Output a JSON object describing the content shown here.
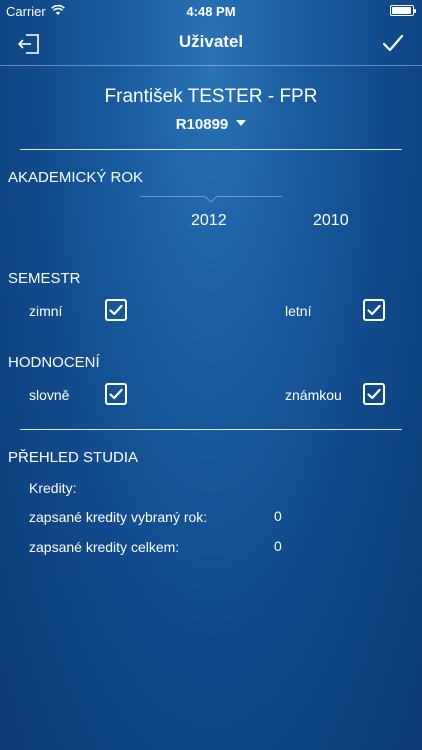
{
  "status_bar": {
    "carrier": "Carrier",
    "time": "4:48 PM"
  },
  "nav": {
    "title": "Uživatel"
  },
  "user": {
    "name": "František TESTER - FPR",
    "id": "R10899"
  },
  "academic_year": {
    "title": "AKADEMICKÝ ROK",
    "years": [
      "2012",
      "2010"
    ]
  },
  "semester": {
    "title": "SEMESTR",
    "options": [
      {
        "label": "zimní",
        "checked": true
      },
      {
        "label": "letní",
        "checked": true
      }
    ]
  },
  "evaluation": {
    "title": "HODNOCENÍ",
    "options": [
      {
        "label": "slovně",
        "checked": true
      },
      {
        "label": "známkou",
        "checked": true
      }
    ]
  },
  "overview": {
    "title": "PŘEHLED STUDIA",
    "credits_label": "Kredity:",
    "rows": [
      {
        "label": "zapsané kredity vybraný rok:",
        "value": "0"
      },
      {
        "label": "zapsané kredity celkem:",
        "value": "0"
      }
    ]
  },
  "colors": {
    "background_top": "#2a73b5",
    "background_bottom": "#0b3a74",
    "foreground": "#ffffff"
  }
}
